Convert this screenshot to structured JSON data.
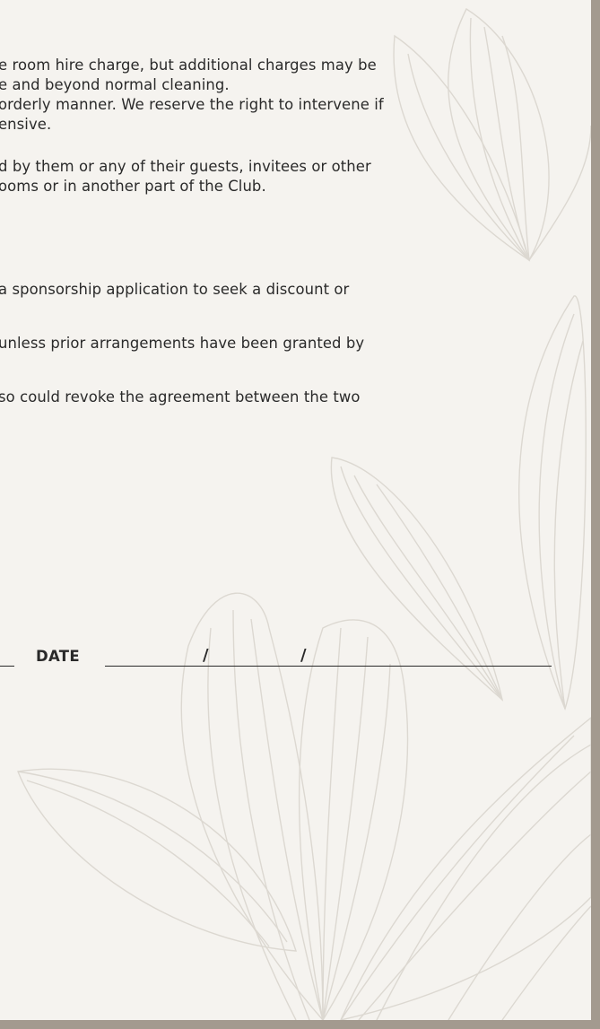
{
  "terms": {
    "lines": [
      "e room hire charge, but additional charges may be",
      "e and beyond normal cleaning.",
      "orderly manner. We reserve the right to intervene if",
      "ensive.",
      "d by them or any of their guests, invitees or other",
      "ooms or in another part of the Club.",
      "a sponsorship application to seek a discount or",
      "unless prior arrangements have been granted by",
      "so could revoke the agreement between the two"
    ]
  },
  "signature": {
    "date_label": "DATE",
    "separator_1": "/",
    "separator_2": "/"
  },
  "colors": {
    "frame": "#a39a8f",
    "paper": "#f5f3ef",
    "text": "#2a2a2a",
    "floral_line": "#dcd8d1"
  }
}
